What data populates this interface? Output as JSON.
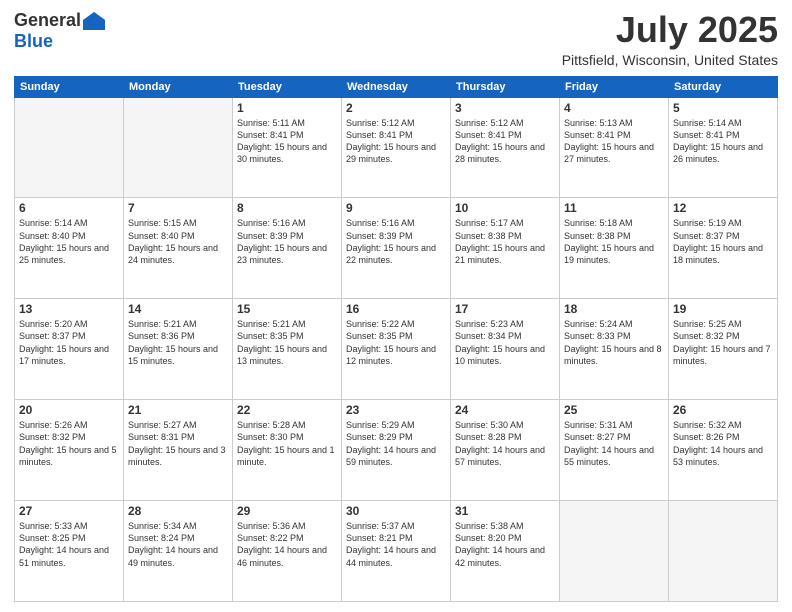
{
  "header": {
    "logo_general": "General",
    "logo_blue": "Blue",
    "month_title": "July 2025",
    "location": "Pittsfield, Wisconsin, United States"
  },
  "weekdays": [
    "Sunday",
    "Monday",
    "Tuesday",
    "Wednesday",
    "Thursday",
    "Friday",
    "Saturday"
  ],
  "weeks": [
    [
      {
        "day": "",
        "content": ""
      },
      {
        "day": "",
        "content": ""
      },
      {
        "day": "1",
        "content": "Sunrise: 5:11 AM\nSunset: 8:41 PM\nDaylight: 15 hours\nand 30 minutes."
      },
      {
        "day": "2",
        "content": "Sunrise: 5:12 AM\nSunset: 8:41 PM\nDaylight: 15 hours\nand 29 minutes."
      },
      {
        "day": "3",
        "content": "Sunrise: 5:12 AM\nSunset: 8:41 PM\nDaylight: 15 hours\nand 28 minutes."
      },
      {
        "day": "4",
        "content": "Sunrise: 5:13 AM\nSunset: 8:41 PM\nDaylight: 15 hours\nand 27 minutes."
      },
      {
        "day": "5",
        "content": "Sunrise: 5:14 AM\nSunset: 8:41 PM\nDaylight: 15 hours\nand 26 minutes."
      }
    ],
    [
      {
        "day": "6",
        "content": "Sunrise: 5:14 AM\nSunset: 8:40 PM\nDaylight: 15 hours\nand 25 minutes."
      },
      {
        "day": "7",
        "content": "Sunrise: 5:15 AM\nSunset: 8:40 PM\nDaylight: 15 hours\nand 24 minutes."
      },
      {
        "day": "8",
        "content": "Sunrise: 5:16 AM\nSunset: 8:39 PM\nDaylight: 15 hours\nand 23 minutes."
      },
      {
        "day": "9",
        "content": "Sunrise: 5:16 AM\nSunset: 8:39 PM\nDaylight: 15 hours\nand 22 minutes."
      },
      {
        "day": "10",
        "content": "Sunrise: 5:17 AM\nSunset: 8:38 PM\nDaylight: 15 hours\nand 21 minutes."
      },
      {
        "day": "11",
        "content": "Sunrise: 5:18 AM\nSunset: 8:38 PM\nDaylight: 15 hours\nand 19 minutes."
      },
      {
        "day": "12",
        "content": "Sunrise: 5:19 AM\nSunset: 8:37 PM\nDaylight: 15 hours\nand 18 minutes."
      }
    ],
    [
      {
        "day": "13",
        "content": "Sunrise: 5:20 AM\nSunset: 8:37 PM\nDaylight: 15 hours\nand 17 minutes."
      },
      {
        "day": "14",
        "content": "Sunrise: 5:21 AM\nSunset: 8:36 PM\nDaylight: 15 hours\nand 15 minutes."
      },
      {
        "day": "15",
        "content": "Sunrise: 5:21 AM\nSunset: 8:35 PM\nDaylight: 15 hours\nand 13 minutes."
      },
      {
        "day": "16",
        "content": "Sunrise: 5:22 AM\nSunset: 8:35 PM\nDaylight: 15 hours\nand 12 minutes."
      },
      {
        "day": "17",
        "content": "Sunrise: 5:23 AM\nSunset: 8:34 PM\nDaylight: 15 hours\nand 10 minutes."
      },
      {
        "day": "18",
        "content": "Sunrise: 5:24 AM\nSunset: 8:33 PM\nDaylight: 15 hours\nand 8 minutes."
      },
      {
        "day": "19",
        "content": "Sunrise: 5:25 AM\nSunset: 8:32 PM\nDaylight: 15 hours\nand 7 minutes."
      }
    ],
    [
      {
        "day": "20",
        "content": "Sunrise: 5:26 AM\nSunset: 8:32 PM\nDaylight: 15 hours\nand 5 minutes."
      },
      {
        "day": "21",
        "content": "Sunrise: 5:27 AM\nSunset: 8:31 PM\nDaylight: 15 hours\nand 3 minutes."
      },
      {
        "day": "22",
        "content": "Sunrise: 5:28 AM\nSunset: 8:30 PM\nDaylight: 15 hours\nand 1 minute."
      },
      {
        "day": "23",
        "content": "Sunrise: 5:29 AM\nSunset: 8:29 PM\nDaylight: 14 hours\nand 59 minutes."
      },
      {
        "day": "24",
        "content": "Sunrise: 5:30 AM\nSunset: 8:28 PM\nDaylight: 14 hours\nand 57 minutes."
      },
      {
        "day": "25",
        "content": "Sunrise: 5:31 AM\nSunset: 8:27 PM\nDaylight: 14 hours\nand 55 minutes."
      },
      {
        "day": "26",
        "content": "Sunrise: 5:32 AM\nSunset: 8:26 PM\nDaylight: 14 hours\nand 53 minutes."
      }
    ],
    [
      {
        "day": "27",
        "content": "Sunrise: 5:33 AM\nSunset: 8:25 PM\nDaylight: 14 hours\nand 51 minutes."
      },
      {
        "day": "28",
        "content": "Sunrise: 5:34 AM\nSunset: 8:24 PM\nDaylight: 14 hours\nand 49 minutes."
      },
      {
        "day": "29",
        "content": "Sunrise: 5:36 AM\nSunset: 8:22 PM\nDaylight: 14 hours\nand 46 minutes."
      },
      {
        "day": "30",
        "content": "Sunrise: 5:37 AM\nSunset: 8:21 PM\nDaylight: 14 hours\nand 44 minutes."
      },
      {
        "day": "31",
        "content": "Sunrise: 5:38 AM\nSunset: 8:20 PM\nDaylight: 14 hours\nand 42 minutes."
      },
      {
        "day": "",
        "content": ""
      },
      {
        "day": "",
        "content": ""
      }
    ]
  ]
}
